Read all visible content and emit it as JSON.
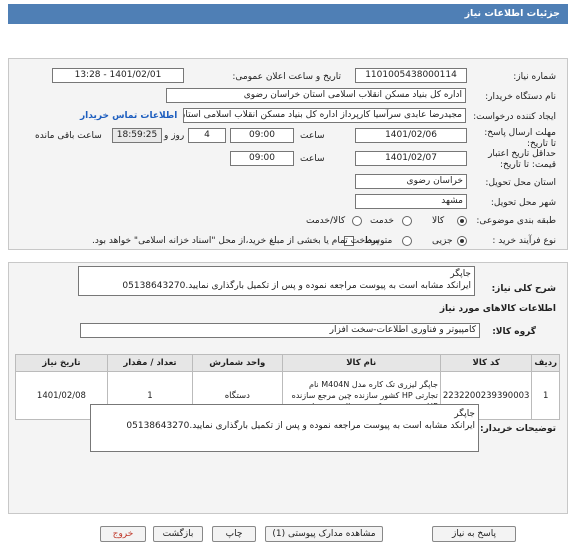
{
  "header": {
    "title": "جزئیات اطلاعات نیاز"
  },
  "form": {
    "need_number": {
      "label": "شماره نیاز:",
      "value": "1101005438000114"
    },
    "announce": {
      "label": "تاریخ و ساعت اعلان عمومی:",
      "value": "1401/02/01 - 13:28"
    },
    "buyer_org": {
      "label": "نام دستگاه خریدار:",
      "value": "اداره کل بنیاد مسکن انقلاب اسلامی استان خراسان رضوی"
    },
    "requester": {
      "label": "ایجاد کننده درخواست:",
      "value": "مجیدرضا عابدی سرآسیا کارپرداز اداره کل بنیاد مسکن انقلاب اسلامی استان خراسان رضوی",
      "contact_link": "اطلاعات تماس خریدار"
    },
    "deadline": {
      "label": "مهلت ارسال پاسخ: تا تاریخ:",
      "date": "1401/02/06",
      "time_label": "ساعت",
      "time": "09:00",
      "days": "4",
      "days_label": "روز و",
      "remaining": "18:59:25",
      "remaining_label": "ساعت باقی مانده"
    },
    "validity": {
      "label": "حداقل تاریخ اعتبار قیمت: تا تاریخ:",
      "date": "1401/02/07",
      "time_label": "ساعت",
      "time": "09:00"
    },
    "province": {
      "label": "استان محل تحویل:",
      "value": "خراسان رضوی"
    },
    "city": {
      "label": "شهر محل تحویل:",
      "value": "مشهد"
    },
    "category": {
      "label": "طبقه بندی موضوعی:",
      "options": [
        "کالا",
        "خدمت",
        "کالا/خدمت"
      ],
      "selected": 0
    },
    "process": {
      "label": "نوع فرآیند خرید :",
      "options": [
        "جزیی",
        "متوسط"
      ],
      "selected": 0,
      "note": "پرداخت تمام یا بخشی از مبلغ خرید،از محل \"اسناد خزانه اسلامی\" خواهد بود."
    }
  },
  "summary": {
    "label": "شرح کلی نیاز:",
    "line1": "جاپگر",
    "line2": "ایرانکد مشابه است به پیوست مراجعه نموده و پس از تکمیل بارگذاری نمایید.05138643270"
  },
  "goods": {
    "section_title": "اطلاعات کالاهای مورد نیاز",
    "group_label": "گروه کالا:",
    "group_value": "کامپیوتر و فناوری اطلاعات-سخت افزار",
    "columns": [
      "ردیف",
      "کد کالا",
      "نام کالا",
      "واحد شمارش",
      "تعداد / مقدار",
      "تاریخ نیاز"
    ],
    "rows": [
      {
        "index": "1",
        "code": "2232200239390003",
        "name": "جاپگر لیزری تک کاره مدل M404N نام تجارتی HP کشور سازنده چین مرجع سازنده HP مرجع عرضه کننده عبدالرحمن زیبائی پور",
        "unit": "دستگاه",
        "qty": "1",
        "date": "1401/02/08"
      }
    ]
  },
  "buyer_notes": {
    "label": "توضیحات خریدار:",
    "line1": "جاپگر",
    "line2": "ایرانکد مشابه است به پیوست مراجعه نموده و پس از تکمیل بارگذاری نمایید.05138643270"
  },
  "buttons": {
    "reply": "پاسخ به نیاز",
    "attachments": "مشاهده مدارک پیوستی (1)",
    "print": "چاپ",
    "back": "بازگشت",
    "exit": "خروج"
  },
  "colors": {
    "header": "#4f7fb5",
    "link": "#1f5fbf",
    "exit": "#c0392b"
  }
}
